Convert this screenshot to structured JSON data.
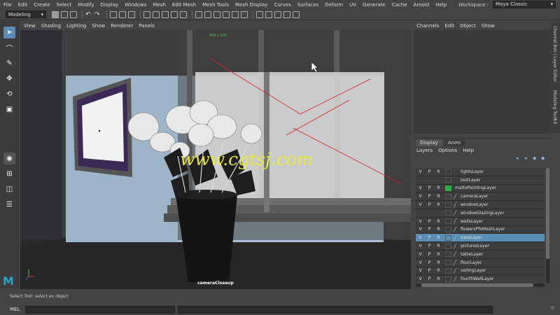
{
  "menubar": {
    "items": [
      "File",
      "Edit",
      "Create",
      "Select",
      "Modify",
      "Display",
      "Windows",
      "Mesh",
      "Edit Mesh",
      "Mesh Tools",
      "Mesh Display",
      "Curves",
      "Surfaces",
      "Deform",
      "UV",
      "Generate",
      "Cache",
      "Arnold",
      "Help"
    ],
    "workspace_label": "Workspace :",
    "workspace_value": "Maya Classic"
  },
  "shelf": {
    "mode": "Modeling"
  },
  "viewport": {
    "menus": [
      "View",
      "Shading",
      "Lighting",
      "Show",
      "Renderer",
      "Panels"
    ],
    "camera_label": "cameraCloseup",
    "resolution_label": "898 x 500",
    "watermark": "www.cgtsj.com"
  },
  "channel_box": {
    "menus": [
      "Channels",
      "Edit",
      "Object",
      "Show"
    ],
    "side_tabs": [
      "Channel Box / Layer Editor",
      "Modeling Toolkit"
    ]
  },
  "layer_editor": {
    "tabs": [
      "Display",
      "Anim"
    ],
    "menus": [
      "Layers",
      "Options",
      "Help"
    ],
    "layers": [
      {
        "v": "V",
        "p": "P",
        "r": "R",
        "name": "lightsLayer",
        "color": "",
        "selected": false
      },
      {
        "v": "",
        "p": "",
        "r": "",
        "name": "testLayer",
        "color": "",
        "selected": false
      },
      {
        "v": "V",
        "p": "P",
        "r": "R",
        "name": "mattePaintingLayer",
        "color": "#2eaa4a",
        "selected": false
      },
      {
        "v": "V",
        "p": "P",
        "r": "R",
        "name": "cameraLayer",
        "color": "",
        "selected": false
      },
      {
        "v": "V",
        "p": "P",
        "r": "R",
        "name": "windowLayer",
        "color": "",
        "selected": false
      },
      {
        "v": "",
        "p": "",
        "r": "",
        "name": "windowGlazingLayer",
        "color": "",
        "selected": false
      },
      {
        "v": "V",
        "p": "P",
        "r": "R",
        "name": "wallsLayer",
        "color": "",
        "selected": false
      },
      {
        "v": "V",
        "p": "P",
        "r": "R",
        "name": "flowersPfxMeshLayer",
        "color": "",
        "selected": false
      },
      {
        "v": "V",
        "p": "P",
        "r": "R",
        "name": "vaseLayer",
        "color": "",
        "selected": true
      },
      {
        "v": "V",
        "p": "P",
        "r": "R",
        "name": "picturesLayer",
        "color": "",
        "selected": false
      },
      {
        "v": "V",
        "p": "P",
        "r": "R",
        "name": "tableLayer",
        "color": "",
        "selected": false
      },
      {
        "v": "V",
        "p": "P",
        "r": "R",
        "name": "floorLayer",
        "color": "",
        "selected": false
      },
      {
        "v": "V",
        "p": "P",
        "r": "R",
        "name": "ceilingLayer",
        "color": "",
        "selected": false
      },
      {
        "v": "V",
        "p": "P",
        "r": "R",
        "name": "fourthWallLayer",
        "color": "",
        "selected": false
      }
    ]
  },
  "status": {
    "help_line": "Select Tool: select an object",
    "mel_label": "MEL"
  }
}
